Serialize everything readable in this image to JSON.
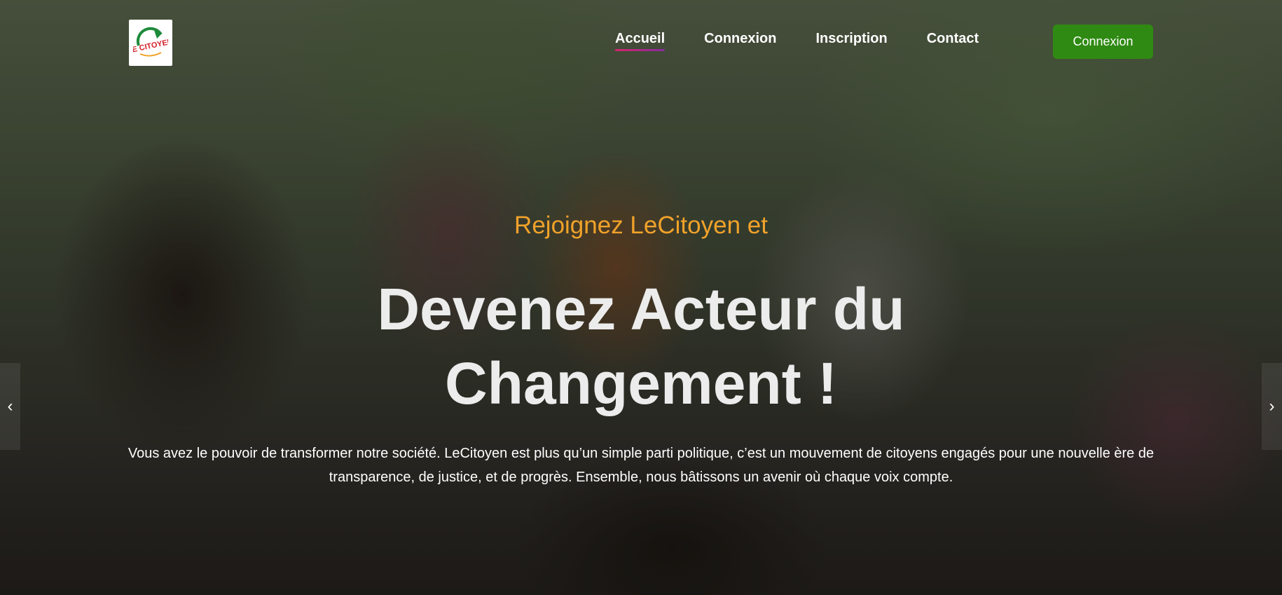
{
  "logo": {
    "alt": "LeCitoyen",
    "icon": "lecitoyen-logo-icon"
  },
  "nav": {
    "items": [
      {
        "label": "Accueil",
        "active": true
      },
      {
        "label": "Connexion",
        "active": false
      },
      {
        "label": "Inscription",
        "active": false
      },
      {
        "label": "Contact",
        "active": false
      }
    ]
  },
  "header_button": {
    "label": "Connexion",
    "color": "#2f8a13"
  },
  "hero": {
    "subtitle": "Rejoignez LeCitoyen et",
    "headline_line1": "Devenez Acteur du",
    "headline_line2": "Changement !",
    "description": "Vous avez le pouvoir de transformer notre société. LeCitoyen est plus qu’un simple parti politique, c’est un mouvement de citoyens engagés pour une nouvelle ère de transparence, de justice, et de progrès. Ensemble, nous bâtissons un avenir où chaque voix compte."
  },
  "carousel": {
    "prev_icon": "chevron-left-icon",
    "next_icon": "chevron-right-icon"
  },
  "colors": {
    "subtitle": "#f1a22a",
    "headline": "#ececec",
    "active_underline_start": "#d6246e",
    "active_underline_end": "#8a2aa0"
  }
}
